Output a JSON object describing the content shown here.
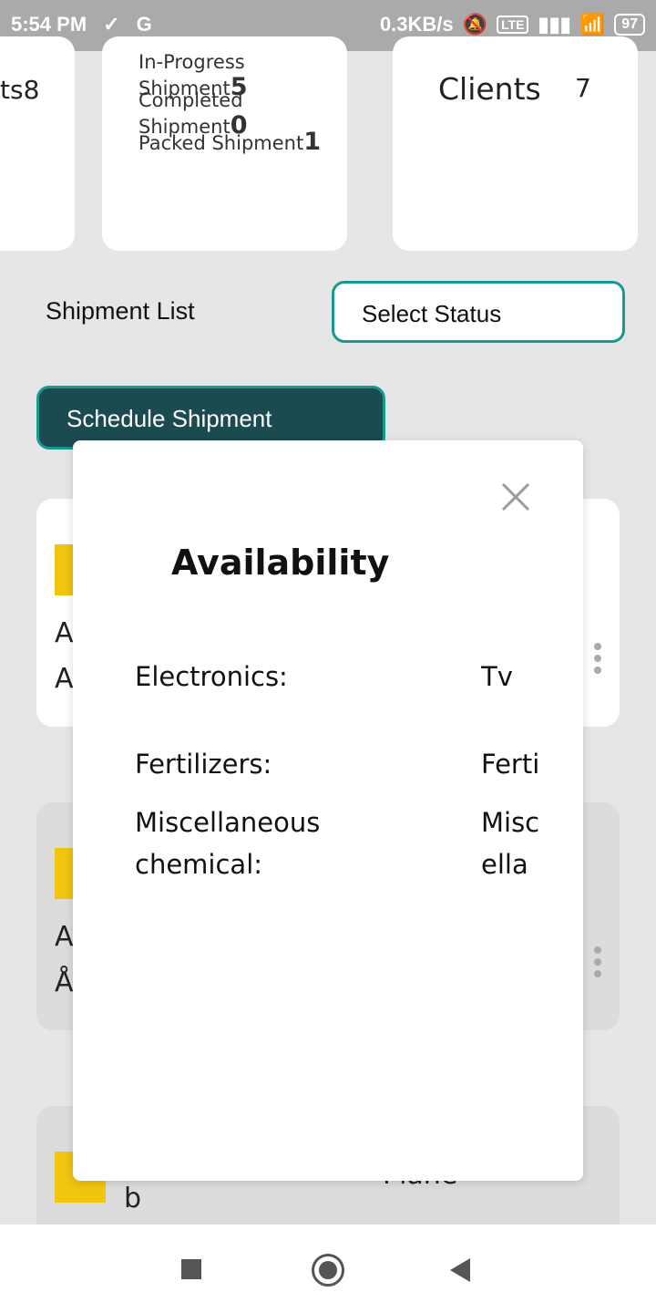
{
  "status_bar": {
    "time": "5:54 PM",
    "left_icons": [
      "check-icon",
      "g-icon"
    ],
    "net_speed": "0.3KB/s",
    "right_icons": [
      "mute-icon",
      "volte-icon",
      "signal-icon",
      "wifi-icon"
    ],
    "battery": "97"
  },
  "dashboard": {
    "card1": {
      "label_fragment": "ts8"
    },
    "card2": {
      "rows": [
        {
          "label": "In-Progress Shipment",
          "count": "5"
        },
        {
          "label": "Completed Shipment",
          "count": "0"
        },
        {
          "label": "Packed Shipment",
          "count": "1"
        }
      ]
    },
    "card3": {
      "label": "Clients",
      "count": "7"
    }
  },
  "shipment_list": {
    "title": "Shipment List",
    "select_placeholder": "Select Status",
    "schedule_button": "Schedule Shipment"
  },
  "background_cards": {
    "card1": {
      "frag1": "A",
      "frag2": "A"
    },
    "card2": {
      "frag1": "A",
      "frag2": "Å"
    },
    "card3": {
      "frag1": "b",
      "frag2": "Plane"
    }
  },
  "modal": {
    "title": "Availability",
    "items": [
      {
        "key": "Electronics:",
        "value": "Tv"
      },
      {
        "key": "Fertilizers:",
        "value": "Ferti"
      },
      {
        "key": "Miscellaneous chemical:",
        "value": "Miscellaneous c"
      }
    ]
  },
  "nav_bar": {
    "icons": [
      "recents-icon",
      "home-icon",
      "back-icon"
    ]
  }
}
